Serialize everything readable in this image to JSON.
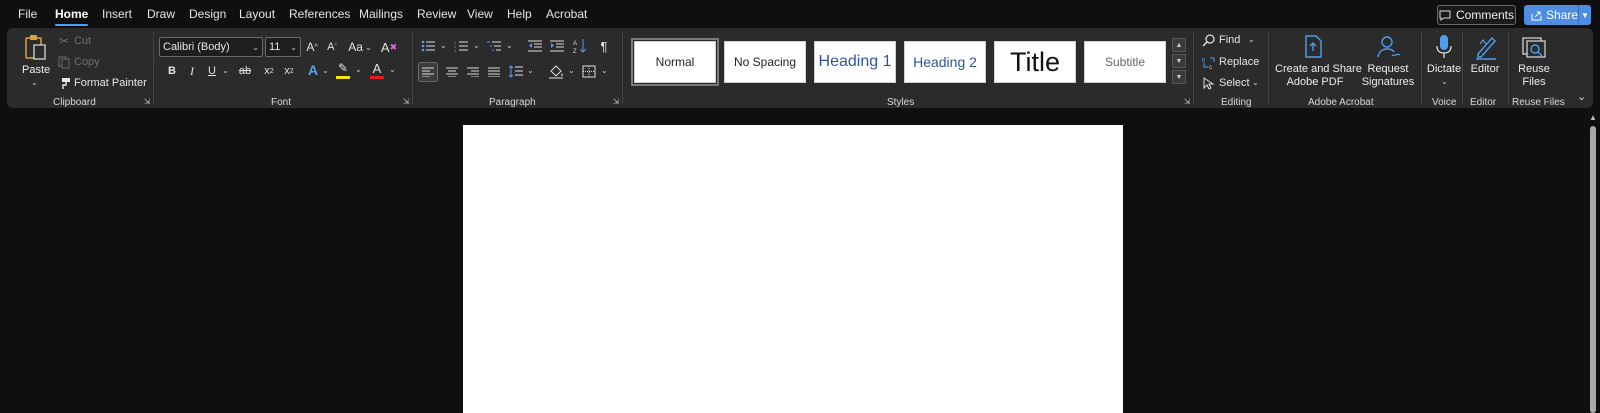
{
  "menu": {
    "tabs": [
      {
        "label": "File"
      },
      {
        "label": "Home",
        "active": true
      },
      {
        "label": "Insert"
      },
      {
        "label": "Draw"
      },
      {
        "label": "Design"
      },
      {
        "label": "Layout"
      },
      {
        "label": "References"
      },
      {
        "label": "Mailings"
      },
      {
        "label": "Review"
      },
      {
        "label": "View"
      },
      {
        "label": "Help"
      },
      {
        "label": "Acrobat"
      }
    ],
    "comments_label": "Comments",
    "share_label": "Share"
  },
  "ribbon": {
    "clipboard": {
      "paste_label": "Paste",
      "cut_label": "Cut",
      "copy_label": "Copy",
      "format_painter_label": "Format Painter",
      "group_label": "Clipboard"
    },
    "font": {
      "font_name": "Calibri (Body)",
      "font_size": "11",
      "change_case_label": "Aa",
      "bold_label": "B",
      "italic_label": "I",
      "underline_label": "U",
      "strike_label": "ab",
      "sub_label": "x",
      "sub_suffix": "2",
      "sup_label": "x",
      "sup_suffix": "2",
      "group_label": "Font"
    },
    "paragraph": {
      "group_label": "Paragraph"
    },
    "styles": {
      "items": [
        {
          "label": "Normal"
        },
        {
          "label": "No Spacing"
        },
        {
          "label": "Heading 1"
        },
        {
          "label": "Heading 2"
        },
        {
          "label": "Title"
        },
        {
          "label": "Subtitle"
        }
      ],
      "group_label": "Styles"
    },
    "editing": {
      "find_label": "Find",
      "replace_label": "Replace",
      "select_label": "Select",
      "group_label": "Editing"
    },
    "acrobat": {
      "create_line1": "Create and Share",
      "create_line2": "Adobe PDF",
      "request_line1": "Request",
      "request_line2": "Signatures",
      "group_label": "Adobe Acrobat"
    },
    "voice": {
      "dictate_label": "Dictate",
      "group_label": "Voice"
    },
    "editor": {
      "editor_label": "Editor",
      "group_label": "Editor"
    },
    "reuse": {
      "line1": "Reuse",
      "line2": "Files",
      "group_label": "Reuse Files"
    }
  },
  "colors": {
    "accent": "#4f9ef0",
    "share_bg": "#4e8de0",
    "highlight": "#f5e50a",
    "font_color": "#e02020",
    "ribbon_bg": "#2b2b2b",
    "app_bg": "#0f0f0f"
  }
}
